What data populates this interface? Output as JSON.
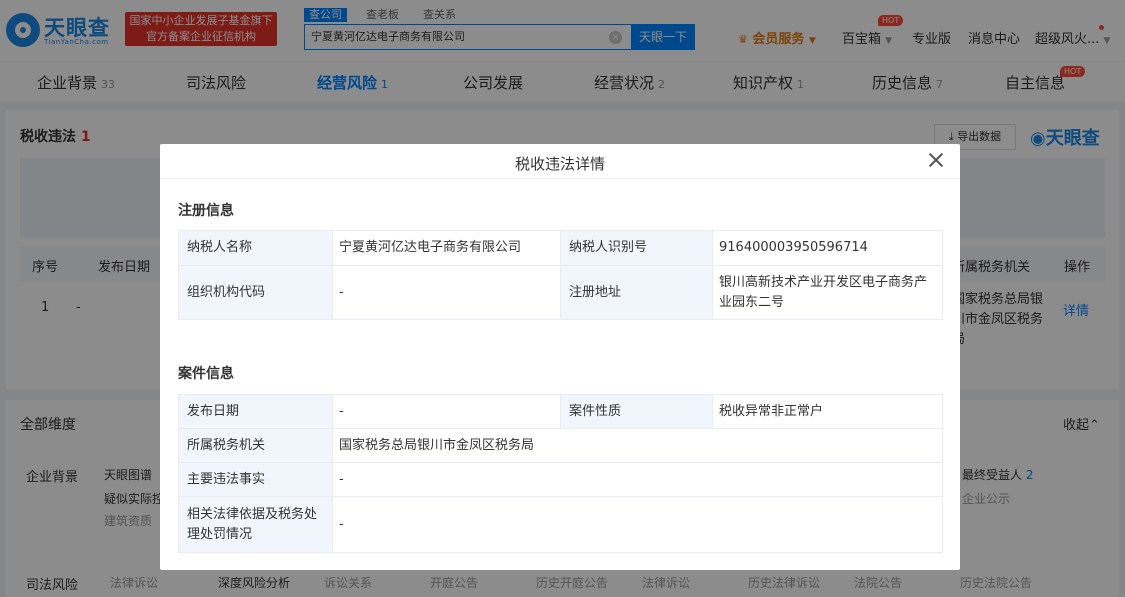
{
  "header": {
    "logo_name": "天眼查",
    "logo_domain": "TianYanCha.com",
    "badge_line1": "国家中小企业发展子基金旗下",
    "badge_line2": "官方备案企业征信机构",
    "search_tabs": [
      "查公司",
      "查老板",
      "查关系"
    ],
    "search_value": "宁夏黄河亿达电子商务有限公司",
    "search_button": "天眼一下",
    "member_label": "会员服务",
    "baibaoxiang": "百宝箱",
    "hot": "HOT",
    "pro": "专业版",
    "messages": "消息中心",
    "user": "超级风火...",
    "colors": {
      "brand": "#0084ff",
      "badge": "#e3332b",
      "hot": "#ff4a3a"
    }
  },
  "tabs": [
    {
      "label": "企业背景",
      "count": "33"
    },
    {
      "label": "司法风险",
      "count": ""
    },
    {
      "label": "经营风险",
      "count": "1"
    },
    {
      "label": "公司发展",
      "count": ""
    },
    {
      "label": "经营状况",
      "count": "2"
    },
    {
      "label": "知识产权",
      "count": "1"
    },
    {
      "label": "历史信息",
      "count": "7"
    },
    {
      "label": "自主信息",
      "count": ""
    }
  ],
  "background": {
    "section_title": "税收违法",
    "section_count": "1",
    "export_label": "导出数据",
    "watermark": "天眼查",
    "table_headers": {
      "index": "序号",
      "date": "发布日期",
      "authority": "所属税务机关",
      "action": "操作"
    },
    "row": {
      "index": "1",
      "date": "-",
      "authority": "国家税务总局银川市金凤区税务局",
      "action": "详情"
    },
    "all_dims": "全部维度",
    "collapse": "收起",
    "dim_background": "企业背景",
    "dim_judicial": "司法风险",
    "items": {
      "tupu": "天眼图谱",
      "actual": "疑似实际控制人",
      "building": "建筑资质",
      "beneficiary": "最终受益人",
      "beneficiary_count": "2",
      "notice": "企业公示",
      "deep": "深度风险分析",
      "lawsuit": "诉讼关系",
      "hearing": "开庭公告",
      "history_ref": "历史开庭公告",
      "doc": "法律诉讼",
      "history_doc": "历史法律诉讼",
      "court": "法院公告",
      "history_court": "历史法院公告"
    }
  },
  "modal": {
    "title": "税收违法详情",
    "reg_title": "注册信息",
    "reg": {
      "taxpayer_name_label": "纳税人名称",
      "taxpayer_name": "宁夏黄河亿达电子商务有限公司",
      "taxpayer_id_label": "纳税人识别号",
      "taxpayer_id": "916400003950596714",
      "org_code_label": "组织机构代码",
      "org_code": "-",
      "address_label": "注册地址",
      "address": "银川高新技术产业开发区电子商务产业园东二号"
    },
    "case_title": "案件信息",
    "case": {
      "date_label": "发布日期",
      "date": "-",
      "nature_label": "案件性质",
      "nature": "税收异常非正常户",
      "authority_label": "所属税务机关",
      "authority": "国家税务总局银川市金凤区税务局",
      "facts_label": "主要违法事实",
      "facts": "-",
      "basis_label": "相关法律依据及税务处理处罚情况",
      "basis": "-"
    }
  }
}
